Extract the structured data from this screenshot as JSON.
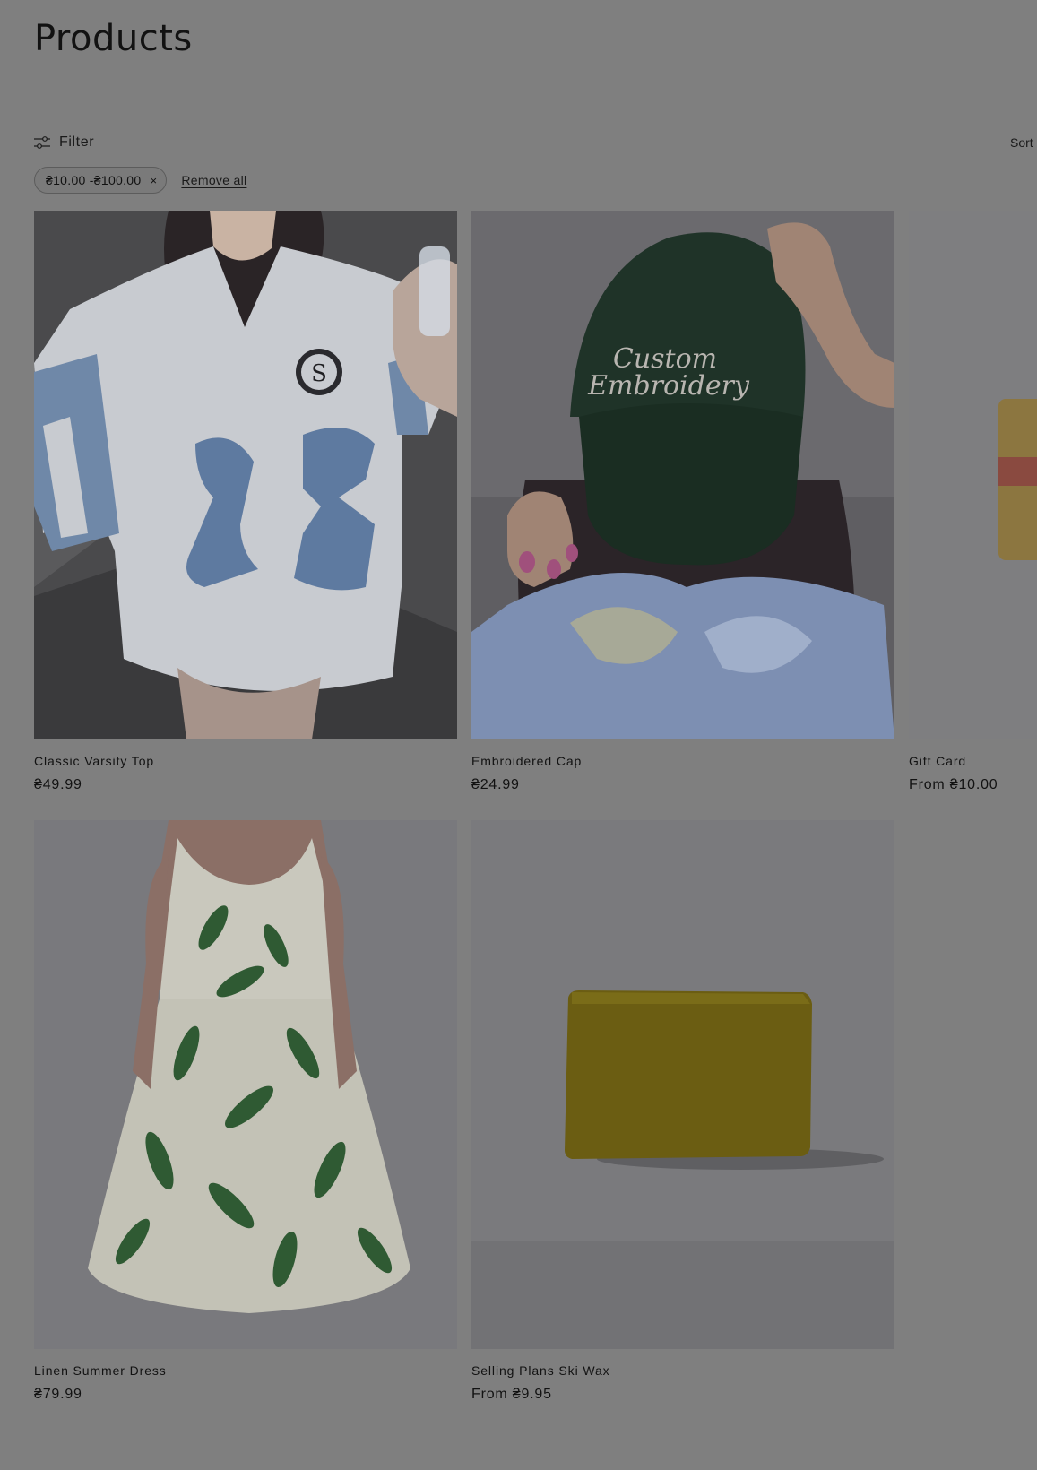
{
  "header": {
    "title": "Products"
  },
  "toolbar": {
    "filter_label": "Filter",
    "sort_label": "Sort by:",
    "filter_icon": "sliders-icon"
  },
  "active_filters": {
    "price_range": "₴10.00 -₴100.00",
    "remove_icon": "close-icon",
    "remove_glyph": "×",
    "remove_all_label": "Remove all"
  },
  "products": [
    {
      "title": "Classic Varsity Top",
      "price": "₴49.99",
      "image": "white varsity jersey with number 23"
    },
    {
      "title": "Embroidered Cap",
      "price": "₴24.99",
      "image": "green cap embroidered Custom Embroidery",
      "cap_text_1": "Custom",
      "cap_text_2": "Embroidery"
    },
    {
      "title": "Gift Card",
      "price": "From ₴10.00",
      "image": "gift card"
    },
    {
      "title": "Linen Summer Dress",
      "price": "₴79.99",
      "image": "leaf print sleeveless dress"
    },
    {
      "title": "Selling Plans Ski Wax",
      "price": "From ₴9.95",
      "image": "yellow wax block"
    }
  ],
  "colors": {
    "overlay_background": "#7f7f7f",
    "text": "#121212"
  }
}
